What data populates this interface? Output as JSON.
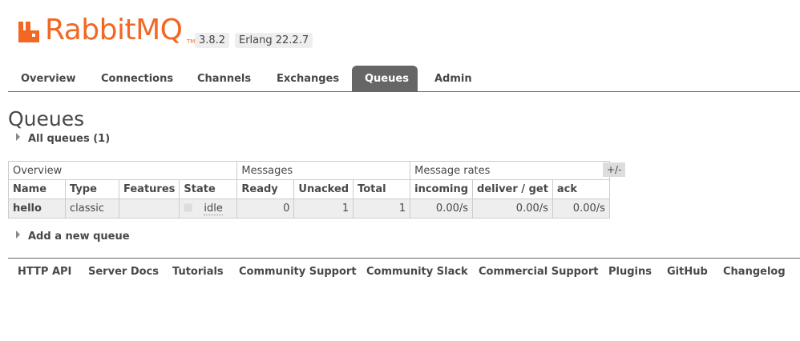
{
  "header": {
    "logo_text": "RabbitMQ",
    "logo_tm": "TM",
    "version": "3.8.2",
    "erlang": "Erlang 22.2.7",
    "brand_color": "#f26724"
  },
  "tabs": [
    {
      "label": "Overview",
      "active": false
    },
    {
      "label": "Connections",
      "active": false
    },
    {
      "label": "Channels",
      "active": false
    },
    {
      "label": "Exchanges",
      "active": false
    },
    {
      "label": "Queues",
      "active": true
    },
    {
      "label": "Admin",
      "active": false
    }
  ],
  "page": {
    "title": "Queues",
    "all_queues": "All queues (1)",
    "add_queue": "Add a new queue",
    "plus_minus": "+/-"
  },
  "table": {
    "groups": [
      "Overview",
      "Messages",
      "Message rates"
    ],
    "columns": [
      "Name",
      "Type",
      "Features",
      "State",
      "Ready",
      "Unacked",
      "Total",
      "incoming",
      "deliver / get",
      "ack"
    ],
    "rows": [
      {
        "name": "hello",
        "type": "classic",
        "features": "",
        "state": "idle",
        "ready": "0",
        "unacked": "1",
        "total": "1",
        "incoming": "0.00/s",
        "deliver_get": "0.00/s",
        "ack": "0.00/s"
      }
    ]
  },
  "footer": [
    "HTTP API",
    "Server Docs",
    "Tutorials",
    "Community Support",
    "Community Slack",
    "Commercial Support",
    "Plugins",
    "GitHub",
    "Changelog"
  ]
}
